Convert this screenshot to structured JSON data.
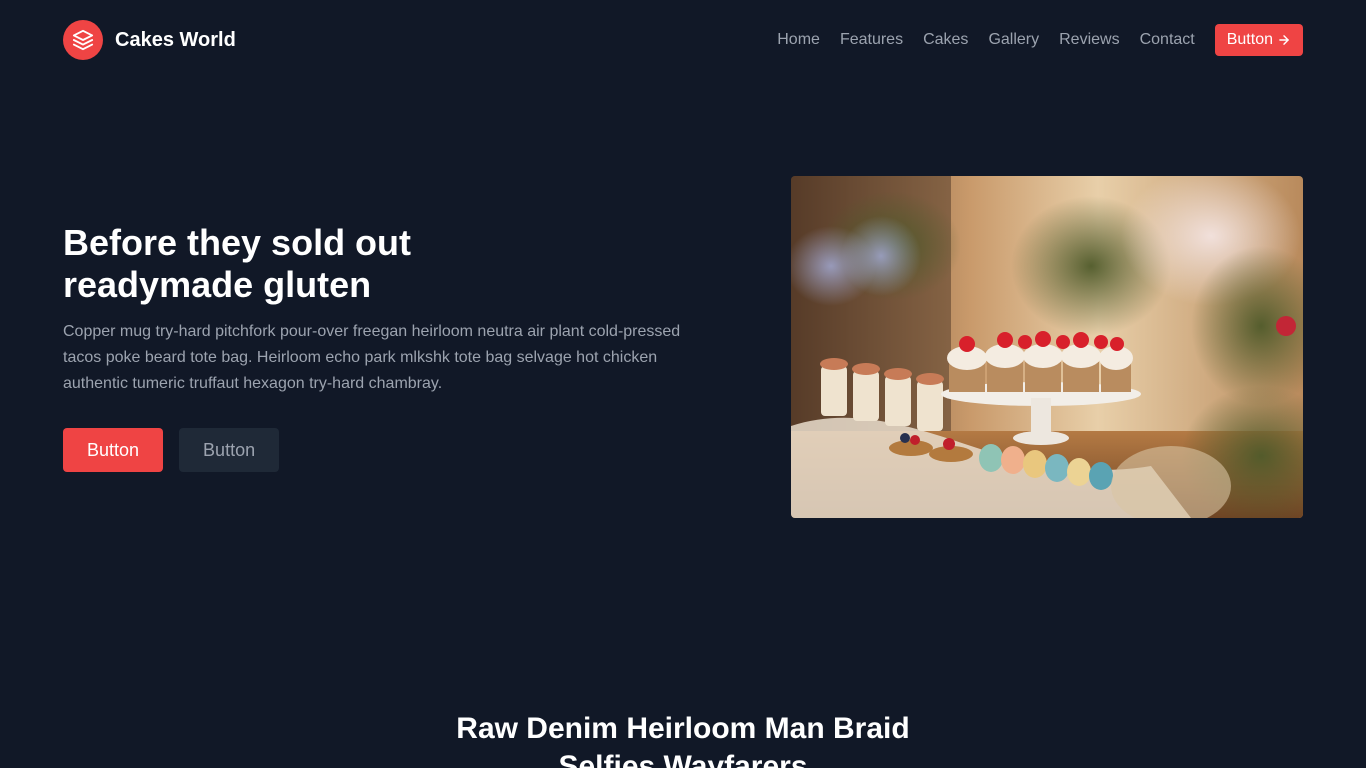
{
  "brand": {
    "name": "Cakes World",
    "logo_icon": "stack-icon",
    "accent": "#ef4444"
  },
  "nav": {
    "links": [
      "Home",
      "Features",
      "Cakes",
      "Gallery",
      "Reviews",
      "Contact"
    ],
    "button_label": "Button",
    "button_icon": "arrow-right-icon"
  },
  "hero": {
    "title_line1": "Before they sold out",
    "title_line2": "readymade gluten",
    "description": "Copper mug try-hard pitchfork pour-over freegan heirloom neutra air plant cold-pressed tacos poke beard tote bag. Heirloom echo park mlkshk tote bag selvage hot chicken authentic tumeric truffaut hexagon try-hard chambray.",
    "primary_button": "Button",
    "secondary_button": "Button"
  },
  "section": {
    "title_line1": "Raw Denim Heirloom Man Braid",
    "title_line2": "Selfies Wayfarers"
  },
  "colors": {
    "background": "#111827",
    "muted_text": "#9ca3af",
    "secondary_button": "#1f2937"
  }
}
